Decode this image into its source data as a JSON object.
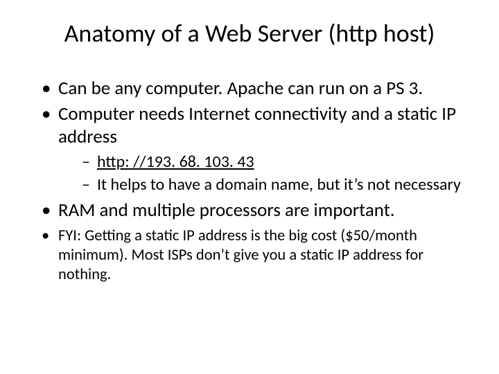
{
  "title": "Anatomy of a Web Server (http host)",
  "bullets": {
    "b1": "Can be any computer.  Apache can run on a PS 3.",
    "b2": "Computer needs Internet connectivity and a static IP address",
    "b2_sub1": "http: //193. 68. 103. 43",
    "b2_sub2": "It helps to have a domain name, but it’s not necessary",
    "b3": "RAM and multiple processors are important.",
    "b4": "FYI: Getting a static IP address is the big cost ($50/month minimum).  Most ISPs don’t give you a static IP address for nothing."
  }
}
